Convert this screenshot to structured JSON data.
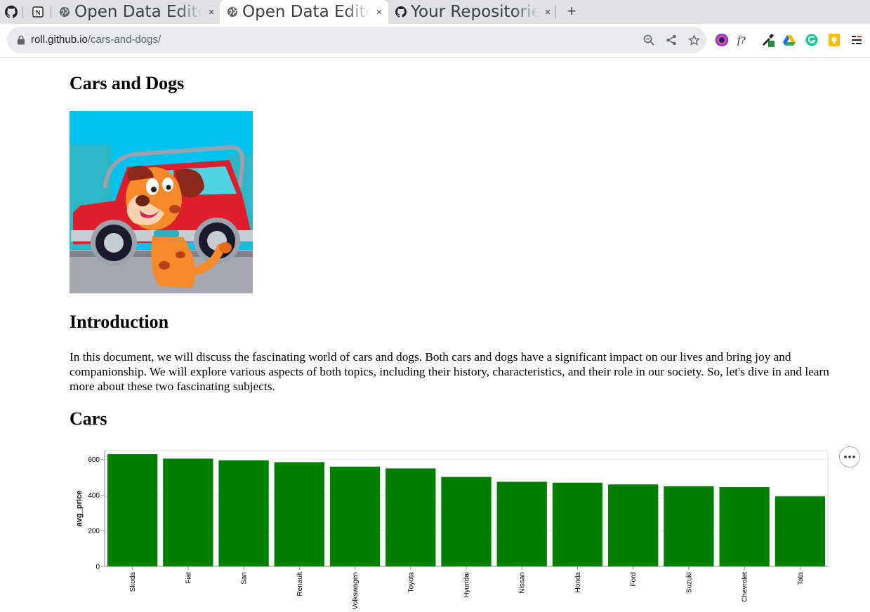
{
  "browser": {
    "tabs": [
      {
        "title": "",
        "icon": "github-icon",
        "pinned": true
      },
      {
        "title": "",
        "icon": "notion-icon",
        "pinned": true
      },
      {
        "title": "Open Data Editor",
        "icon": "globe-icon",
        "active": false
      },
      {
        "title": "Open Data Editor",
        "icon": "globe-icon",
        "active": true
      },
      {
        "title": "Your Repositories",
        "icon": "github-icon",
        "active": false
      }
    ],
    "new_tab_label": "+",
    "close_glyph": "×",
    "url_host": "roll.github.io",
    "url_path": "/cars-and-dogs/",
    "extensions": [
      "color-picker-icon",
      "formula-icon",
      "eyedropper-icon",
      "google-drive-icon",
      "grammarly-icon",
      "keep-icon",
      "menu-extension-icon"
    ]
  },
  "page": {
    "title": "Cars and Dogs",
    "hero_image": "cartoon-dog-car-image",
    "intro_heading": "Introduction",
    "intro_text": "In this document, we will discuss the fascinating world of cars and dogs. Both cars and dogs have a significant impact on our lives and bring joy and companionship. We will explore various aspects of both topics, including their history, characteristics, and their role in our society. So, let's dive in and learn more about these two fascinating subjects.",
    "cars_heading": "Cars",
    "chart_actions_icon": "more-horizontal-icon"
  },
  "chart_data": {
    "type": "bar",
    "categories": [
      "Skoda",
      "Fiat",
      "San",
      "Renault",
      "Volkswagen",
      "Toyota",
      "Hyundai",
      "Nissan",
      "Honda",
      "Ford",
      "Suzuki",
      "Chevrolet",
      "Tata"
    ],
    "values": [
      630,
      605,
      595,
      585,
      560,
      550,
      502,
      475,
      470,
      460,
      450,
      445,
      393
    ],
    "ylabel": "avg_price",
    "xlabel": "",
    "ylim": [
      0,
      650
    ],
    "yticks": [
      0,
      200,
      400,
      600
    ],
    "bar_color": "#008000",
    "grid": true
  }
}
